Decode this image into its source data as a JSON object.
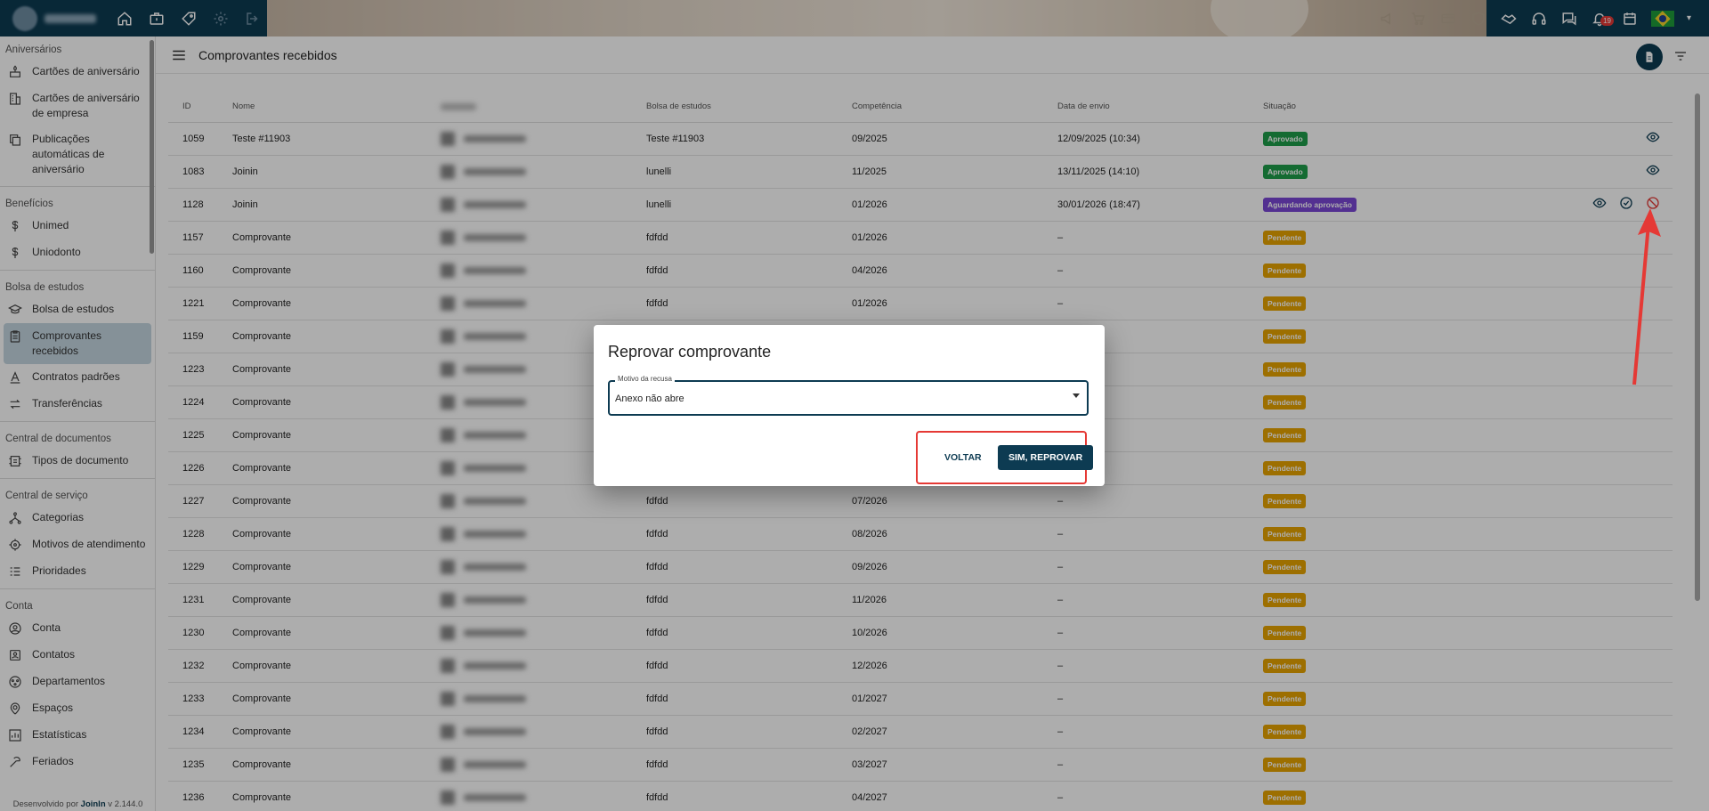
{
  "topbar": {
    "nav_icons": [
      "home-icon",
      "briefcase-icon",
      "ticket-icon",
      "gear-icon",
      "logout-icon"
    ],
    "right_icons": [
      "megaphone-icon",
      "cart-icon",
      "card-icon",
      "shield-icon",
      "handshake-icon",
      "headset-icon",
      "chat-icon",
      "bell-icon",
      "calendar-icon"
    ],
    "notification_count": "19"
  },
  "sidebar": {
    "sections": [
      {
        "title": "Aniversários",
        "items": [
          {
            "label": "Cartões de aniversário",
            "icon": "cake-icon"
          },
          {
            "label": "Cartões de aniversário de empresa",
            "icon": "building-icon"
          },
          {
            "label": "Publicações automáticas de aniversário",
            "icon": "copy-icon"
          }
        ]
      },
      {
        "title": "Benefícios",
        "items": [
          {
            "label": "Unimed",
            "icon": "dollar-icon"
          },
          {
            "label": "Uniodonto",
            "icon": "dollar-icon"
          }
        ]
      },
      {
        "title": "Bolsa de estudos",
        "items": [
          {
            "label": "Bolsa de estudos",
            "icon": "school-icon"
          },
          {
            "label": "Comprovantes recebidos",
            "icon": "clipboard-icon",
            "active": true
          },
          {
            "label": "Contratos padrões",
            "icon": "text-format-icon"
          },
          {
            "label": "Transferências",
            "icon": "swap-icon"
          }
        ]
      },
      {
        "title": "Central de documentos",
        "items": [
          {
            "label": "Tipos de documento",
            "icon": "document-type-icon"
          }
        ]
      },
      {
        "title": "Central de serviço",
        "items": [
          {
            "label": "Categorias",
            "icon": "hierarchy-icon"
          },
          {
            "label": "Motivos de atendimento",
            "icon": "target-icon"
          },
          {
            "label": "Prioridades",
            "icon": "list-icon"
          }
        ]
      },
      {
        "title": "Conta",
        "items": [
          {
            "label": "Conta",
            "icon": "account-icon"
          },
          {
            "label": "Contatos",
            "icon": "contacts-icon"
          },
          {
            "label": "Departamentos",
            "icon": "departments-icon"
          },
          {
            "label": "Espaços",
            "icon": "spaces-icon"
          },
          {
            "label": "Estatísticas",
            "icon": "stats-icon"
          },
          {
            "label": "Feriados",
            "icon": "holiday-icon"
          }
        ]
      }
    ],
    "footer_prefix": "Desenvolvido por ",
    "footer_brand": "Joinln",
    "footer_version": " v 2.144.0"
  },
  "page": {
    "title": "Comprovantes recebidos"
  },
  "table": {
    "columns": [
      "ID",
      "Nome",
      "",
      "Bolsa de estudos",
      "Competência",
      "Data de envio",
      "Situação"
    ],
    "rows": [
      {
        "id": "1059",
        "nome": "Teste #11903",
        "bolsa": "Teste #11903",
        "competencia": "09/2025",
        "data": "12/09/2025 (10:34)",
        "situacao": "Aprovado",
        "tipo": "ok",
        "acoes": [
          "view"
        ]
      },
      {
        "id": "1083",
        "nome": "Joinin",
        "bolsa": "lunelli",
        "competencia": "11/2025",
        "data": "13/11/2025 (14:10)",
        "situacao": "Aprovado",
        "tipo": "ok",
        "acoes": [
          "view"
        ]
      },
      {
        "id": "1128",
        "nome": "Joinin",
        "bolsa": "lunelli",
        "competencia": "01/2026",
        "data": "30/01/2026 (18:47)",
        "situacao": "Aguardando aprovação",
        "tipo": "wait",
        "acoes": [
          "view",
          "approve",
          "reject"
        ]
      },
      {
        "id": "1157",
        "nome": "Comprovante",
        "bolsa": "fdfdd",
        "competencia": "01/2026",
        "data": "–",
        "situacao": "Pendente",
        "tipo": "pend",
        "acoes": []
      },
      {
        "id": "1160",
        "nome": "Comprovante",
        "bolsa": "fdfdd",
        "competencia": "04/2026",
        "data": "–",
        "situacao": "Pendente",
        "tipo": "pend",
        "acoes": []
      },
      {
        "id": "1221",
        "nome": "Comprovante",
        "bolsa": "fdfdd",
        "competencia": "01/2026",
        "data": "–",
        "situacao": "Pendente",
        "tipo": "pend",
        "acoes": []
      },
      {
        "id": "1159",
        "nome": "Comprovante",
        "bolsa": "",
        "competencia": "",
        "data": "",
        "situacao": "Pendente",
        "tipo": "pend",
        "acoes": []
      },
      {
        "id": "1223",
        "nome": "Comprovante",
        "bolsa": "",
        "competencia": "",
        "data": "",
        "situacao": "Pendente",
        "tipo": "pend",
        "acoes": []
      },
      {
        "id": "1224",
        "nome": "Comprovante",
        "bolsa": "",
        "competencia": "",
        "data": "",
        "situacao": "Pendente",
        "tipo": "pend",
        "acoes": []
      },
      {
        "id": "1225",
        "nome": "Comprovante",
        "bolsa": "",
        "competencia": "",
        "data": "",
        "situacao": "Pendente",
        "tipo": "pend",
        "acoes": []
      },
      {
        "id": "1226",
        "nome": "Comprovante",
        "bolsa": "",
        "competencia": "",
        "data": "",
        "situacao": "Pendente",
        "tipo": "pend",
        "acoes": []
      },
      {
        "id": "1227",
        "nome": "Comprovante",
        "bolsa": "fdfdd",
        "competencia": "07/2026",
        "data": "–",
        "situacao": "Pendente",
        "tipo": "pend",
        "acoes": []
      },
      {
        "id": "1228",
        "nome": "Comprovante",
        "bolsa": "fdfdd",
        "competencia": "08/2026",
        "data": "–",
        "situacao": "Pendente",
        "tipo": "pend",
        "acoes": []
      },
      {
        "id": "1229",
        "nome": "Comprovante",
        "bolsa": "fdfdd",
        "competencia": "09/2026",
        "data": "–",
        "situacao": "Pendente",
        "tipo": "pend",
        "acoes": []
      },
      {
        "id": "1231",
        "nome": "Comprovante",
        "bolsa": "fdfdd",
        "competencia": "11/2026",
        "data": "–",
        "situacao": "Pendente",
        "tipo": "pend",
        "acoes": []
      },
      {
        "id": "1230",
        "nome": "Comprovante",
        "bolsa": "fdfdd",
        "competencia": "10/2026",
        "data": "–",
        "situacao": "Pendente",
        "tipo": "pend",
        "acoes": []
      },
      {
        "id": "1232",
        "nome": "Comprovante",
        "bolsa": "fdfdd",
        "competencia": "12/2026",
        "data": "–",
        "situacao": "Pendente",
        "tipo": "pend",
        "acoes": []
      },
      {
        "id": "1233",
        "nome": "Comprovante",
        "bolsa": "fdfdd",
        "competencia": "01/2027",
        "data": "–",
        "situacao": "Pendente",
        "tipo": "pend",
        "acoes": []
      },
      {
        "id": "1234",
        "nome": "Comprovante",
        "bolsa": "fdfdd",
        "competencia": "02/2027",
        "data": "–",
        "situacao": "Pendente",
        "tipo": "pend",
        "acoes": []
      },
      {
        "id": "1235",
        "nome": "Comprovante",
        "bolsa": "fdfdd",
        "competencia": "03/2027",
        "data": "–",
        "situacao": "Pendente",
        "tipo": "pend",
        "acoes": []
      },
      {
        "id": "1236",
        "nome": "Comprovante",
        "bolsa": "fdfdd",
        "competencia": "04/2027",
        "data": "–",
        "situacao": "Pendente",
        "tipo": "pend",
        "acoes": []
      }
    ]
  },
  "dialog": {
    "title": "Reprovar comprovante",
    "field_label": "Motivo da recusa",
    "field_value": "Anexo não abre",
    "back_label": "VOLTAR",
    "confirm_label": "SIM, REPROVAR"
  },
  "colors": {
    "primary": "#0d3b52",
    "approved": "#1e9e4a",
    "awaiting": "#7b48d6",
    "pending": "#e8a400",
    "annotation": "#e53935"
  }
}
